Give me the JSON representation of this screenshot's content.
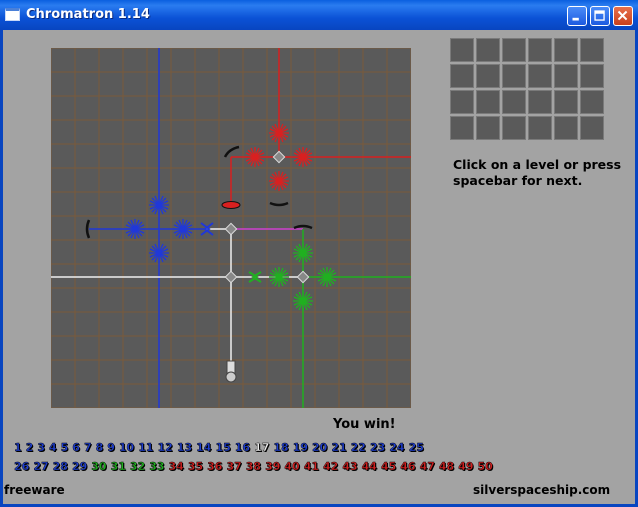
{
  "window": {
    "title": "Chromatron 1.14"
  },
  "hint": "Click on a level or press spacebar for next.",
  "status": "You win!",
  "levels_row1": [
    {
      "n": "1",
      "c": "blue"
    },
    {
      "n": "2",
      "c": "blue"
    },
    {
      "n": "3",
      "c": "blue"
    },
    {
      "n": "4",
      "c": "blue"
    },
    {
      "n": "5",
      "c": "blue"
    },
    {
      "n": "6",
      "c": "blue"
    },
    {
      "n": "7",
      "c": "blue"
    },
    {
      "n": "8",
      "c": "blue"
    },
    {
      "n": "9",
      "c": "blue"
    },
    {
      "n": "10",
      "c": "blue"
    },
    {
      "n": "11",
      "c": "blue"
    },
    {
      "n": "12",
      "c": "blue"
    },
    {
      "n": "13",
      "c": "blue"
    },
    {
      "n": "14",
      "c": "blue"
    },
    {
      "n": "15",
      "c": "blue"
    },
    {
      "n": "16",
      "c": "blue"
    },
    {
      "n": "17",
      "c": "white"
    },
    {
      "n": "18",
      "c": "blue"
    },
    {
      "n": "19",
      "c": "blue"
    },
    {
      "n": "20",
      "c": "blue"
    },
    {
      "n": "21",
      "c": "blue"
    },
    {
      "n": "22",
      "c": "blue"
    },
    {
      "n": "23",
      "c": "blue"
    },
    {
      "n": "24",
      "c": "blue"
    },
    {
      "n": "25",
      "c": "blue"
    }
  ],
  "levels_row2": [
    {
      "n": "26",
      "c": "blue"
    },
    {
      "n": "27",
      "c": "blue"
    },
    {
      "n": "28",
      "c": "blue"
    },
    {
      "n": "29",
      "c": "blue"
    },
    {
      "n": "30",
      "c": "green"
    },
    {
      "n": "31",
      "c": "green"
    },
    {
      "n": "32",
      "c": "green"
    },
    {
      "n": "33",
      "c": "green"
    },
    {
      "n": "34",
      "c": "red"
    },
    {
      "n": "35",
      "c": "red"
    },
    {
      "n": "36",
      "c": "red"
    },
    {
      "n": "37",
      "c": "red"
    },
    {
      "n": "38",
      "c": "red"
    },
    {
      "n": "39",
      "c": "red"
    },
    {
      "n": "40",
      "c": "red"
    },
    {
      "n": "41",
      "c": "red"
    },
    {
      "n": "42",
      "c": "red"
    },
    {
      "n": "43",
      "c": "red"
    },
    {
      "n": "44",
      "c": "red"
    },
    {
      "n": "45",
      "c": "red"
    },
    {
      "n": "46",
      "c": "red"
    },
    {
      "n": "47",
      "c": "red"
    },
    {
      "n": "48",
      "c": "red"
    },
    {
      "n": "49",
      "c": "red"
    },
    {
      "n": "50",
      "c": "red"
    }
  ],
  "footer_left": "freeware",
  "footer_right": "silverspaceship.com",
  "colors": {
    "board": "#5a5a5a",
    "grid": "#7a5a3a",
    "blue": "#1f3fd0",
    "red": "#d02020",
    "green": "#20b020"
  }
}
